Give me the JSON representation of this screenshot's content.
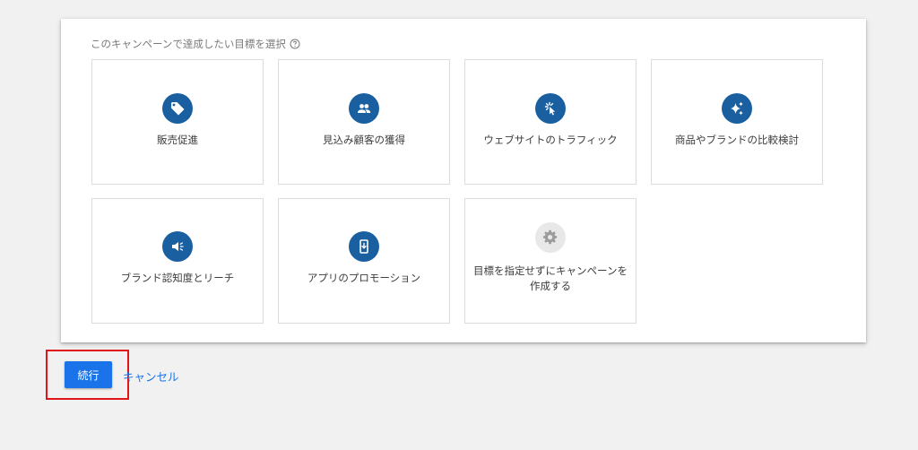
{
  "goal_selection": {
    "question": "このキャンペーンで達成したい目標を選択",
    "help_icon": "help-circle-icon",
    "tiles": [
      {
        "label": "販売促進",
        "icon": "tag-icon"
      },
      {
        "label": "見込み顧客の獲得",
        "icon": "people-icon"
      },
      {
        "label": "ウェブサイトのトラフィック",
        "icon": "cursor-click-icon"
      },
      {
        "label": "商品やブランドの比較検討",
        "icon": "sparkle-icon"
      },
      {
        "label": "ブランド認知度とリーチ",
        "icon": "megaphone-icon"
      },
      {
        "label": "アプリのプロモーション",
        "icon": "phone-download-icon"
      },
      {
        "label_line1": "目標を指定せずにキャンペーンを",
        "label_line2": "作成する",
        "icon": "gear-icon"
      }
    ]
  },
  "actions": {
    "continue_label": "続行",
    "cancel_label": "キャンセル"
  },
  "colors": {
    "icon_bg": "#1a5fa0",
    "primary_button": "#1a73e8",
    "highlight_border": "#e0151b"
  }
}
